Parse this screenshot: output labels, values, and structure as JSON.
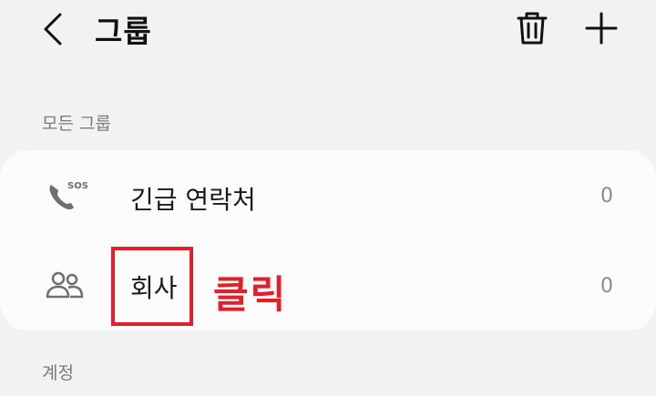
{
  "header": {
    "title": "그룹",
    "back_icon": "chevron-left-icon",
    "trash_icon": "trash-icon",
    "add_icon": "plus-icon"
  },
  "sections": [
    {
      "label": "모든 그룹",
      "items": [
        {
          "label": "긴급 연락처",
          "count": "0",
          "icon": "phone-sos-icon"
        },
        {
          "label": "회사",
          "count": "0",
          "icon": "people-icon"
        }
      ]
    },
    {
      "label": "계정"
    }
  ],
  "annotation": {
    "text": "클릭",
    "color": "#e0202a"
  },
  "colors": {
    "background": "#f2f2f2",
    "card": "#fbfbfb",
    "annotation_red": "#e0202a"
  }
}
